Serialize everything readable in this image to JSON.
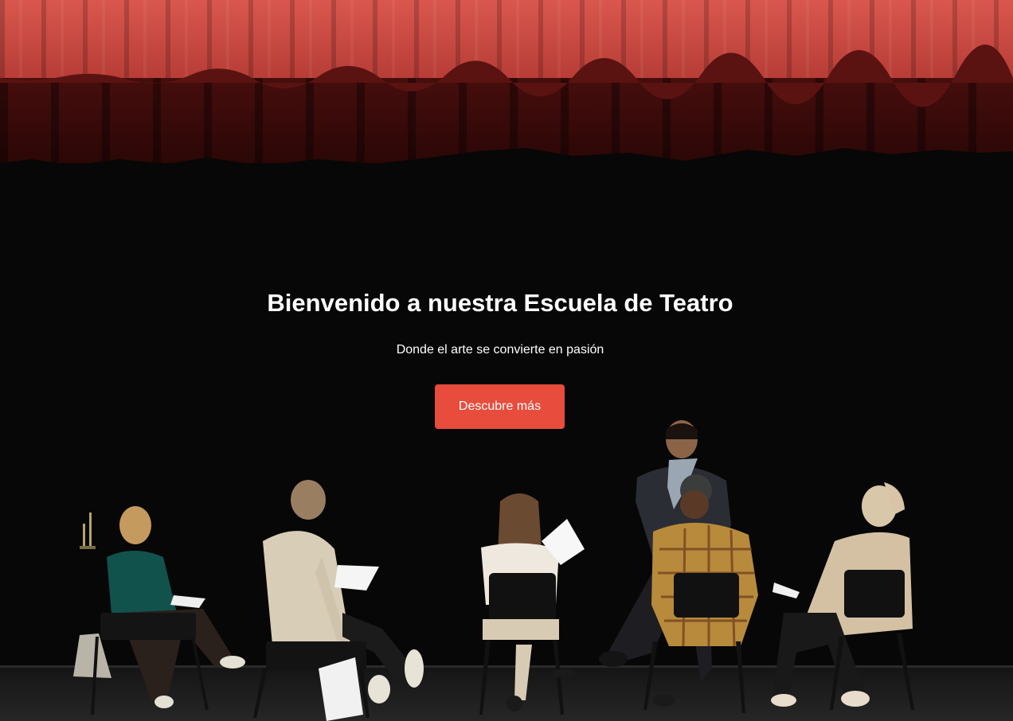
{
  "hero": {
    "title": "Bienvenido a nuestra Escuela de Teatro",
    "subtitle": "Donde el arte se convierte en pasión",
    "cta_label": "Descubre más"
  },
  "colors": {
    "accent": "#e74c3c",
    "text": "#ffffff",
    "background": "#070707",
    "curtain": "#c0463f"
  }
}
